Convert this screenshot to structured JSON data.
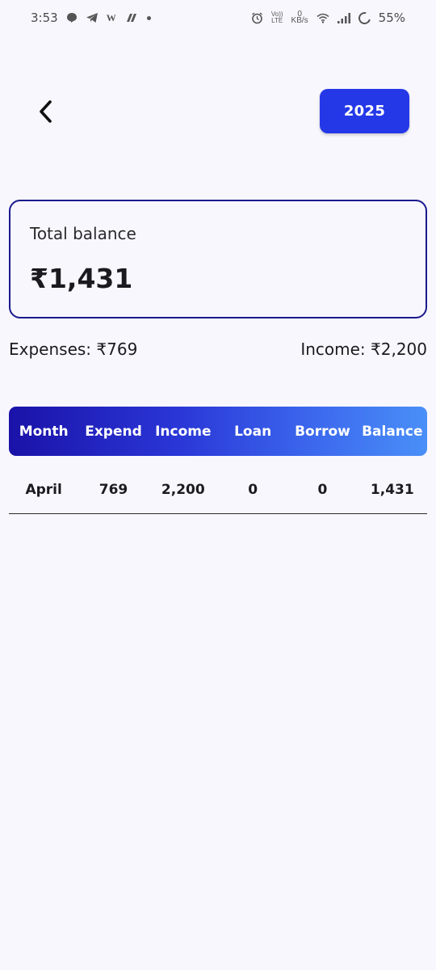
{
  "status_bar": {
    "time": "3:53",
    "battery": "55%",
    "net_speed_value": "0",
    "net_speed_unit": "KB/s",
    "volte_label_top": "Vo))",
    "volte_label_bottom": "LTE",
    "wifi_label": "W",
    "icons": [
      "messages-icon",
      "telegram-icon",
      "wps-icon",
      "cloud-icon",
      "dot-icon",
      "alarm-icon",
      "volte-icon",
      "wifi-icon",
      "signal-icon",
      "battery-icon"
    ]
  },
  "header": {
    "back_icon": "chevron-left-icon",
    "year": "2025"
  },
  "balance_card": {
    "label": "Total balance",
    "value": "₹1,431"
  },
  "summary": {
    "expenses": "Expenses: ₹769",
    "income": "Income: ₹2,200"
  },
  "table": {
    "headers": [
      "Month",
      "Expend",
      "Income",
      "Loan",
      "Borrow",
      "Balance"
    ],
    "rows": [
      [
        "April",
        "769",
        "2,200",
        "0",
        "0",
        "1,431"
      ]
    ]
  },
  "colors": {
    "background": "#f8f7fe",
    "year_button": "#2438e8",
    "card_border": "#1a1a8c",
    "header_gradient_start": "#1a12a8",
    "header_gradient_end": "#4a8ff8"
  }
}
